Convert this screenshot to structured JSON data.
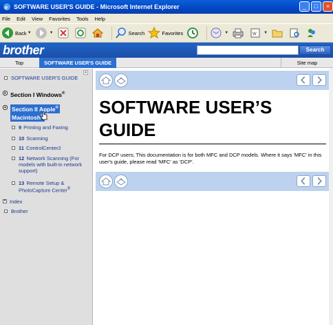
{
  "window": {
    "title": "SOFTWARE USER'S GUIDE - Microsoft Internet Explorer"
  },
  "menu": [
    "File",
    "Edit",
    "View",
    "Favorites",
    "Tools",
    "Help"
  ],
  "toolbar": {
    "back": "Back",
    "search": "Search",
    "favorites": "Favorites"
  },
  "brother": {
    "logo": "brother",
    "search_placeholder": "",
    "search_button": "Search"
  },
  "nav": {
    "top": "Top",
    "guide": "SOFTWARE USER'S GUIDE",
    "sitemap": "Site map"
  },
  "sidebar": {
    "guide_link": "SOFTWARE USER'S GUIDE",
    "section1": "Section I Windows",
    "section1_sup": "®",
    "section2": "Section II Apple",
    "section2_sup": "®",
    "section2_line2": "Macintosh",
    "section2_line2_sup": "®",
    "items": [
      {
        "num": "9",
        "label": "Printing and Faxing"
      },
      {
        "num": "10",
        "label": "Scanning"
      },
      {
        "num": "11",
        "label": "ControlCenter2"
      },
      {
        "num": "12",
        "label": "Network Scanning (For models with built-in network support)"
      },
      {
        "num": "13",
        "label": "Remote Setup & PhotoCapture Center",
        "sup": "®"
      }
    ],
    "index": "Index",
    "brother": "Brother"
  },
  "content": {
    "title": "SOFTWARE USER’S GUIDE",
    "description": "For DCP users; This documentation is for both MFC and DCP models. Where it says 'MFC' in this user's guide, please read 'MFC' as 'DCP'."
  }
}
